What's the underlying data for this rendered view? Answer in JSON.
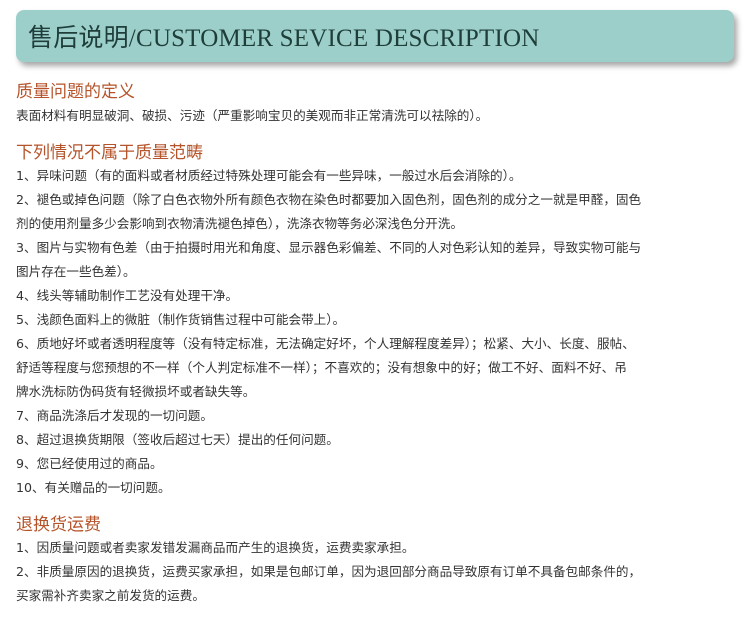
{
  "header": {
    "title": "售后说明/CUSTOMER SEVICE DESCRIPTION"
  },
  "sections": [
    {
      "heading": "质量问题的定义",
      "lines": [
        "表面材料有明显破洞、破损、污迹（严重影响宝贝的美观而非正常清洗可以祛除的）。"
      ]
    },
    {
      "heading": "下列情况不属于质量范畴",
      "lines": [
        "1、异味问题（有的面料或者材质经过特殊处理可能会有一些异味，一般过水后会消除的）。",
        "2、褪色或掉色问题（除了白色衣物外所有颜色衣物在染色时都要加入固色剂，固色剂的成分之一就是甲醛，固色",
        "剂的使用剂量多少会影响到衣物清洗褪色掉色），洗涤衣物等务必深浅色分开洗。",
        "3、图片与实物有色差（由于拍摄时用光和角度、显示器色彩偏差、不同的人对色彩认知的差异，导致实物可能与",
        "图片存在一些色差）。",
        "4、线头等辅助制作工艺没有处理干净。",
        "5、浅颜色面料上的微脏（制作货销售过程中可能会带上）。",
        "6、质地好坏或者透明程度等（没有特定标准，无法确定好坏，个人理解程度差异）；松紧、大小、长度、服帖、",
        "舒适等程度与您预想的不一样（个人判定标准不一样）；不喜欢的；没有想象中的好；做工不好、面料不好、吊",
        "牌水洗标防伪码货有轻微损坏或者缺失等。",
        "7、商品洗涤后才发现的一切问题。",
        "8、超过退换货期限（签收后超过七天）提出的任何问题。",
        "9、您已经使用过的商品。",
        "10、有关赠品的一切问题。"
      ]
    },
    {
      "heading": "退换货运费",
      "lines": [
        "1、因质量问题或者卖家发错发漏商品而产生的退换货，运费卖家承担。",
        "2、非质量原因的退换货，运费买家承担，如果是包邮订单，因为退回部分商品导致原有订单不具备包邮条件的，",
        "买家需补齐卖家之前发货的运费。"
      ]
    }
  ]
}
